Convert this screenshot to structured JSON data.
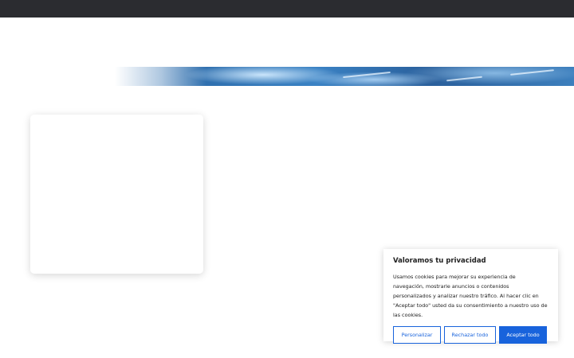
{
  "cookie_banner": {
    "title": "Valoramos tu privacidad",
    "description": "Usamos cookies para mejorar su experiencia de navegación, mostrarle anuncios o contenidos personalizados y analizar nuestro tráfico. Al hacer clic en \"Aceptar todo\" usted da su consentimiento a nuestro uso de las cookies.",
    "customize_label": "Personalizar",
    "reject_label": "Rechazar todo",
    "accept_label": "Aceptar todo"
  },
  "colors": {
    "topbar": "#2b2c30",
    "accent": "#1863dc",
    "text": "#212121"
  }
}
